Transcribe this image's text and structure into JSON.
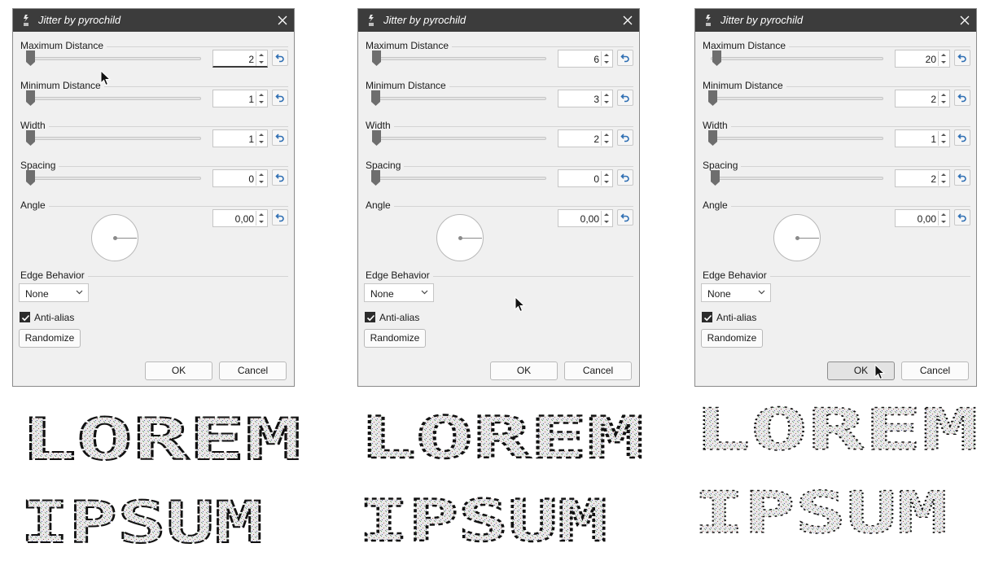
{
  "colors": {
    "titlebar": "#3c3c3c",
    "reset_arrow": "#2f6fb3",
    "window_bg": "#f0f0f0"
  },
  "dialogs": [
    {
      "title": "Jitter by pyrochild",
      "max_distance_label": "Maximum Distance",
      "max_distance_value": "2",
      "min_distance_label": "Minimum Distance",
      "min_distance_value": "1",
      "width_label": "Width",
      "width_value": "1",
      "spacing_label": "Spacing",
      "spacing_value": "0",
      "angle_label": "Angle",
      "angle_value": "0,00",
      "edge_behavior_label": "Edge Behavior",
      "edge_behavior_value": "None",
      "antialias_label": "Anti-alias",
      "antialias_checked": true,
      "randomize_label": "Randomize",
      "ok_label": "OK",
      "cancel_label": "Cancel"
    },
    {
      "title": "Jitter by pyrochild",
      "max_distance_label": "Maximum Distance",
      "max_distance_value": "6",
      "min_distance_label": "Minimum Distance",
      "min_distance_value": "3",
      "width_label": "Width",
      "width_value": "2",
      "spacing_label": "Spacing",
      "spacing_value": "0",
      "angle_label": "Angle",
      "angle_value": "0,00",
      "edge_behavior_label": "Edge Behavior",
      "edge_behavior_value": "None",
      "antialias_label": "Anti-alias",
      "antialias_checked": true,
      "randomize_label": "Randomize",
      "ok_label": "OK",
      "cancel_label": "Cancel"
    },
    {
      "title": "Jitter by pyrochild",
      "max_distance_label": "Maximum Distance",
      "max_distance_value": "20",
      "min_distance_label": "Minimum Distance",
      "min_distance_value": "2",
      "width_label": "Width",
      "width_value": "1",
      "spacing_label": "Spacing",
      "spacing_value": "2",
      "angle_label": "Angle",
      "angle_value": "0,00",
      "edge_behavior_label": "Edge Behavior",
      "edge_behavior_value": "None",
      "antialias_label": "Anti-alias",
      "antialias_checked": true,
      "randomize_label": "Randomize",
      "ok_label": "OK",
      "cancel_label": "Cancel"
    }
  ],
  "previews": [
    {
      "words": [
        "LOREM",
        "IPSUM"
      ]
    },
    {
      "words": [
        "LOREM",
        "IPSUM"
      ]
    },
    {
      "words": [
        "LOREM",
        "IPSUM"
      ]
    }
  ]
}
